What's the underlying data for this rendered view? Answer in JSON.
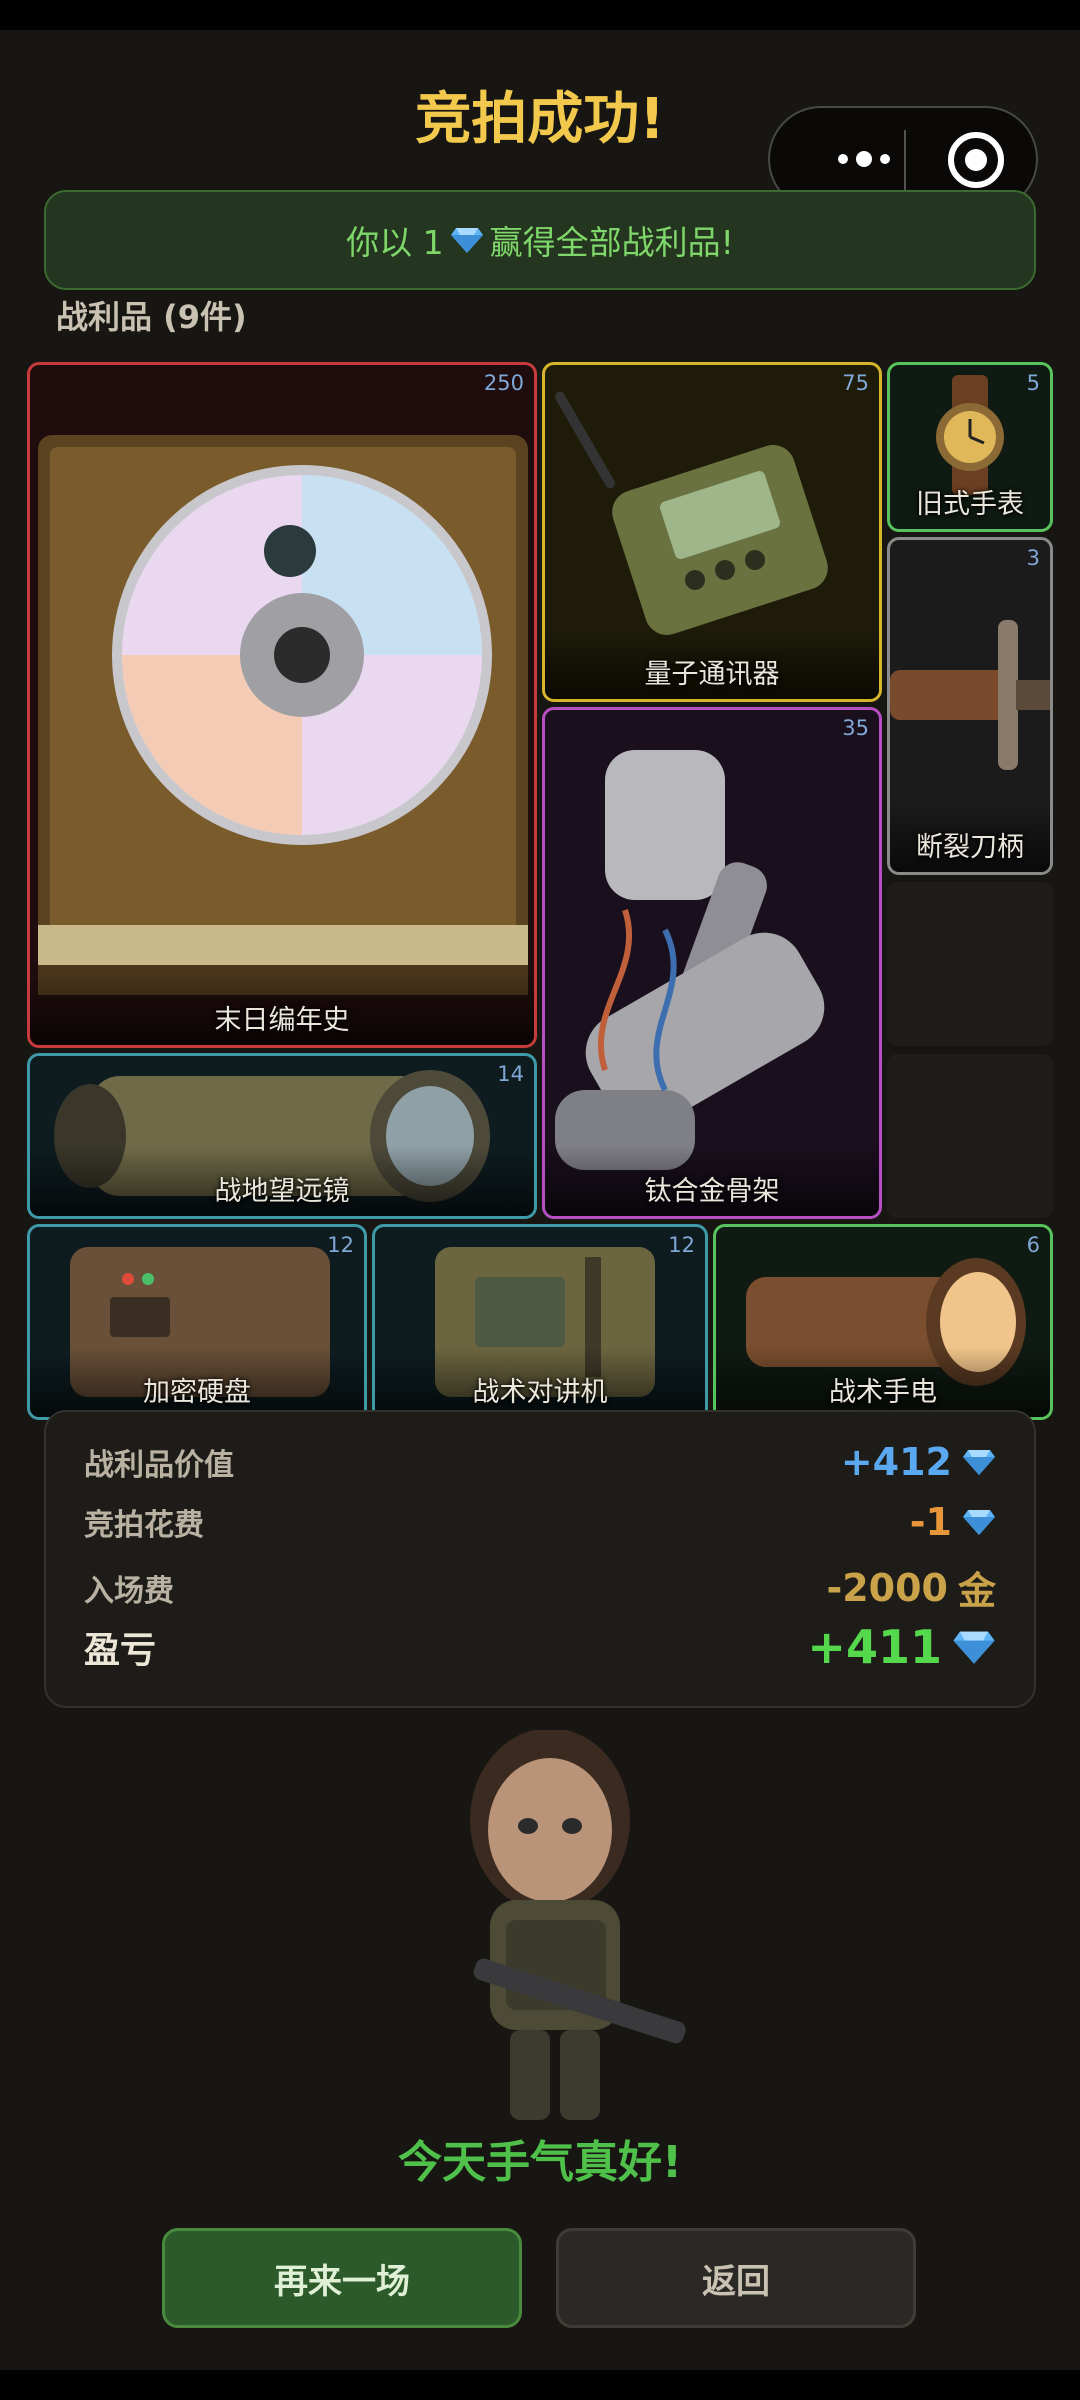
{
  "header": {
    "title": "竞拍成功!"
  },
  "banner": {
    "prefix": "你以 1",
    "suffix": "赢得全部战利品!"
  },
  "loot": {
    "heading": "战利品 (9件)",
    "items": [
      {
        "name": "末日编年史",
        "qty": "250",
        "rarity": "red"
      },
      {
        "name": "量子通讯器",
        "qty": "75",
        "rarity": "yellow"
      },
      {
        "name": "旧式手表",
        "qty": "5",
        "rarity": "green"
      },
      {
        "name": "断裂刀柄",
        "qty": "3",
        "rarity": "gray"
      },
      {
        "name": "钛合金骨架",
        "qty": "35",
        "rarity": "purple"
      },
      {
        "name": "战地望远镜",
        "qty": "14",
        "rarity": "cyan"
      },
      {
        "name": "加密硬盘",
        "qty": "12",
        "rarity": "cyan"
      },
      {
        "name": "战术对讲机",
        "qty": "12",
        "rarity": "cyan"
      },
      {
        "name": "战术手电",
        "qty": "6",
        "rarity": "green"
      }
    ]
  },
  "summary": {
    "loot_value": {
      "label": "战利品价值",
      "value": "+412"
    },
    "bid_cost": {
      "label": "竞拍花费",
      "value": "-1"
    },
    "entry_fee": {
      "label": "入场费",
      "value": "-2000",
      "unit": "金"
    },
    "profit": {
      "label": "盈亏",
      "value": "+411"
    }
  },
  "character": {
    "message": "今天手气真好!"
  },
  "buttons": {
    "again": "再来一场",
    "back": "返回"
  },
  "colors": {
    "title": "#f2c94c",
    "accent_green": "#55d84c",
    "diamond_blue": "#5aa9f0",
    "rarity_red": "#c63b3b",
    "rarity_yellow": "#d6b52c",
    "rarity_green": "#58c25c",
    "rarity_purple": "#b54fc2",
    "rarity_cyan": "#3f9aa8"
  },
  "icons": [
    "diamond-icon",
    "more-dots-icon",
    "close-circle-icon"
  ]
}
